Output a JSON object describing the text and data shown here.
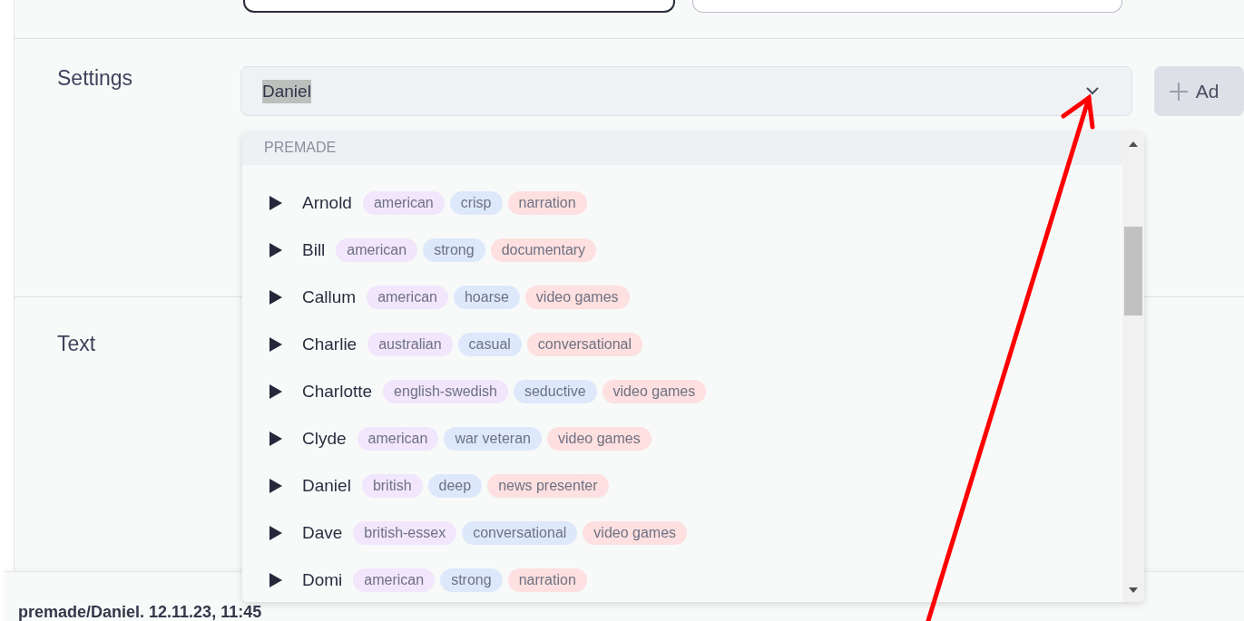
{
  "settings": {
    "label": "Settings",
    "voice_field": {
      "value": "Daniel",
      "value_highlighted": true
    },
    "add_button": {
      "label": "Ad"
    }
  },
  "text_section": {
    "label": "Text"
  },
  "voice_dropdown": {
    "group_header": "PREMADE",
    "voices": [
      {
        "name": "Arnold",
        "accent": "american",
        "description": "crisp",
        "use_case": "narration"
      },
      {
        "name": "Bill",
        "accent": "american",
        "description": "strong",
        "use_case": "documentary"
      },
      {
        "name": "Callum",
        "accent": "american",
        "description": "hoarse",
        "use_case": "video games"
      },
      {
        "name": "Charlie",
        "accent": "australian",
        "description": "casual",
        "use_case": "conversational"
      },
      {
        "name": "Charlotte",
        "accent": "english-swedish",
        "description": "seductive",
        "use_case": "video games"
      },
      {
        "name": "Clyde",
        "accent": "american",
        "description": "war veteran",
        "use_case": "video games"
      },
      {
        "name": "Daniel",
        "accent": "british",
        "description": "deep",
        "use_case": "news presenter"
      },
      {
        "name": "Dave",
        "accent": "british-essex",
        "description": "conversational",
        "use_case": "video games"
      },
      {
        "name": "Domi",
        "accent": "american",
        "description": "strong",
        "use_case": "narration"
      }
    ]
  },
  "history_bar": {
    "text": "premade/Daniel. 12.11.23, 11:45"
  }
}
